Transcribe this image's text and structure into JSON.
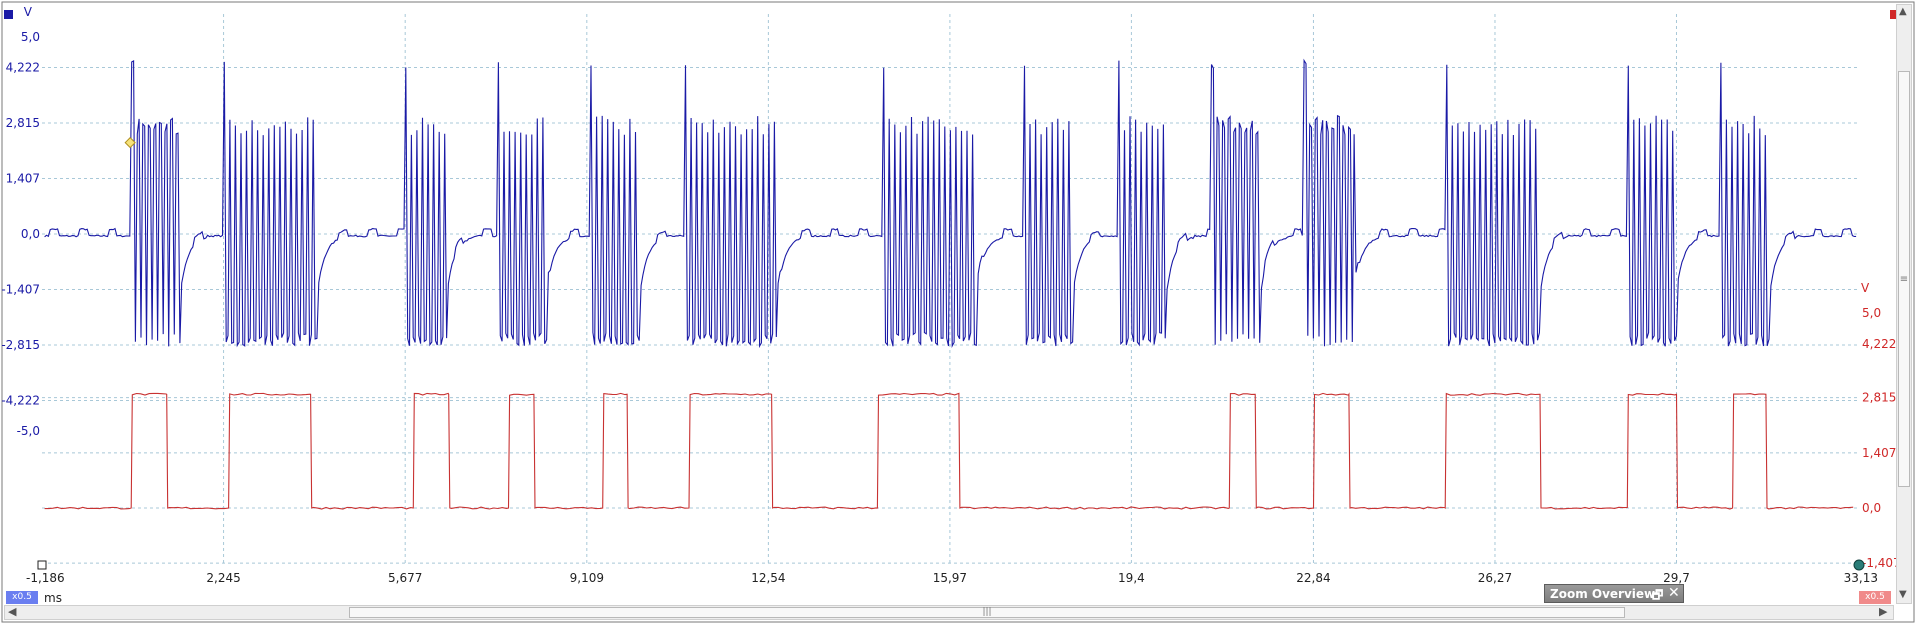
{
  "chart_data": {
    "type": "line",
    "title": "",
    "colors": {
      "channel_a": "#1a1aa6",
      "channel_b": "#c83232",
      "grid": "#a8c8d8"
    },
    "x_axis": {
      "unit": "ms",
      "range": [
        -1.186,
        33.13
      ],
      "ticks": [
        -1.186,
        2.245,
        5.677,
        9.109,
        12.54,
        15.97,
        19.4,
        22.84,
        26.27,
        29.7,
        33.13
      ],
      "tick_labels": [
        "-1,186",
        "2,245",
        "5,677",
        "9,109",
        "12,54",
        "15,97",
        "19,4",
        "22,84",
        "26,27",
        "29,7",
        "33,13"
      ],
      "multiplier": "x0.5"
    },
    "y_axis_left": {
      "unit": "V",
      "range": [
        -5.0,
        5.0
      ],
      "tick_values": [
        5.0,
        4.222,
        2.815,
        1.407,
        0.0,
        -1.407,
        -2.815,
        -4.222,
        -5.0
      ],
      "tick_labels": [
        "5,0",
        "4,222",
        "2,815",
        "1,407",
        "0,0",
        "-1,407",
        "-2,815",
        "-4,222",
        "-5,0"
      ]
    },
    "y_axis_right": {
      "unit": "V",
      "range": [
        -1.407,
        5.0
      ],
      "tick_values": [
        5.0,
        4.222,
        2.815,
        1.407,
        0.0,
        -1.407
      ],
      "tick_labels": [
        "5,0",
        "4,222",
        "2,815",
        "1,407",
        "0,0",
        "-1,407"
      ],
      "multiplier": "x0.5"
    },
    "grid": true,
    "series": [
      {
        "channel": "A",
        "axis": "left",
        "baseline_v": 0.0,
        "burst_amplitude_v": [
          -2.5,
          3.0
        ],
        "first_spike_v": 4.4,
        "bursts_ms": [
          [
            0.5,
            1.43
          ],
          [
            2.24,
            4.02
          ],
          [
            5.66,
            6.47
          ],
          [
            7.41,
            8.35
          ],
          [
            9.17,
            10.12
          ],
          [
            10.94,
            12.72
          ],
          [
            14.69,
            16.47
          ],
          [
            17.35,
            18.3
          ],
          [
            19.13,
            20.07
          ],
          [
            20.9,
            21.85
          ],
          [
            22.66,
            23.61
          ],
          [
            25.33,
            27.13
          ],
          [
            28.76,
            29.7
          ],
          [
            30.52,
            31.47
          ]
        ]
      },
      {
        "channel": "B",
        "axis": "right",
        "low_v": 0.0,
        "high_v": 2.9,
        "high_intervals_ms": [
          [
            0.5,
            1.17
          ],
          [
            2.34,
            3.89
          ],
          [
            5.83,
            6.5
          ],
          [
            7.63,
            8.11
          ],
          [
            9.41,
            9.87
          ],
          [
            11.04,
            12.6
          ],
          [
            14.6,
            16.14
          ],
          [
            21.25,
            21.74
          ],
          [
            22.84,
            23.51
          ],
          [
            25.33,
            27.12
          ],
          [
            28.77,
            29.7
          ],
          [
            30.76,
            31.39
          ]
        ]
      }
    ],
    "cursor_marker_ms": 0.48,
    "cursor_marker_v": 2.3
  },
  "overlay": {
    "zoom_overview_label": "Zoom Overview",
    "restore_glyph": "🗗",
    "close_glyph": "✕"
  }
}
